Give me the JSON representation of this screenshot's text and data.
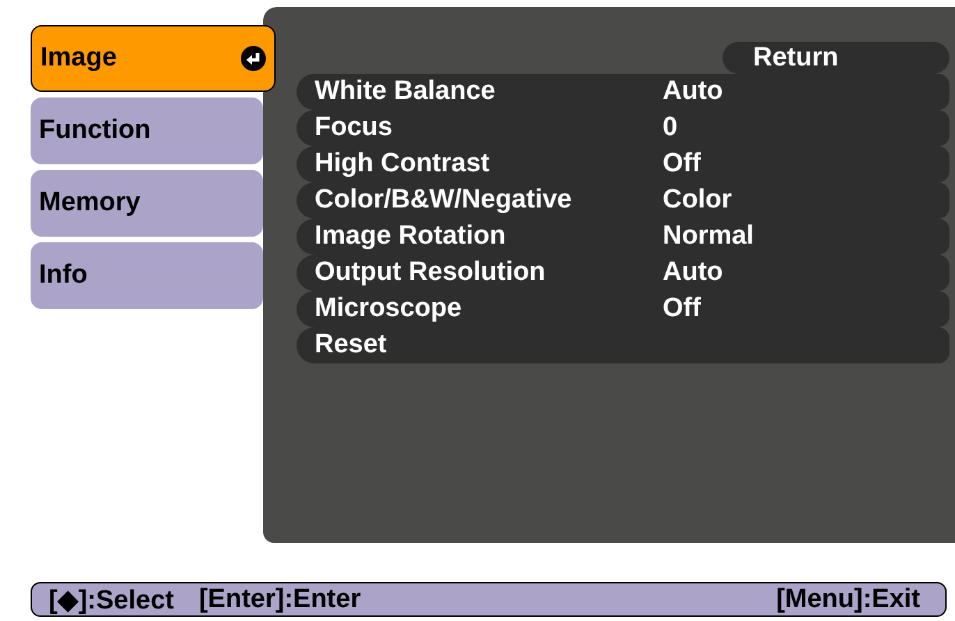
{
  "tabs": [
    {
      "label": "Image",
      "selected": true
    },
    {
      "label": "Function",
      "selected": false
    },
    {
      "label": "Memory",
      "selected": false
    },
    {
      "label": "Info",
      "selected": false
    }
  ],
  "return_button": "Return",
  "settings": [
    {
      "label": "White Balance",
      "value": "Auto"
    },
    {
      "label": "Focus",
      "value": "0"
    },
    {
      "label": "High Contrast",
      "value": "Off"
    },
    {
      "label": "Color/B&W/Negative",
      "value": "Color"
    },
    {
      "label": "Image Rotation",
      "value": "Normal"
    },
    {
      "label": "Output Resolution",
      "value": "Auto"
    },
    {
      "label": "Microscope",
      "value": "Off"
    },
    {
      "label": "Reset"
    }
  ],
  "status_bar": {
    "left": [
      "[◆]:Select",
      "[Enter]:Enter"
    ],
    "right": "[Menu]:Exit"
  }
}
